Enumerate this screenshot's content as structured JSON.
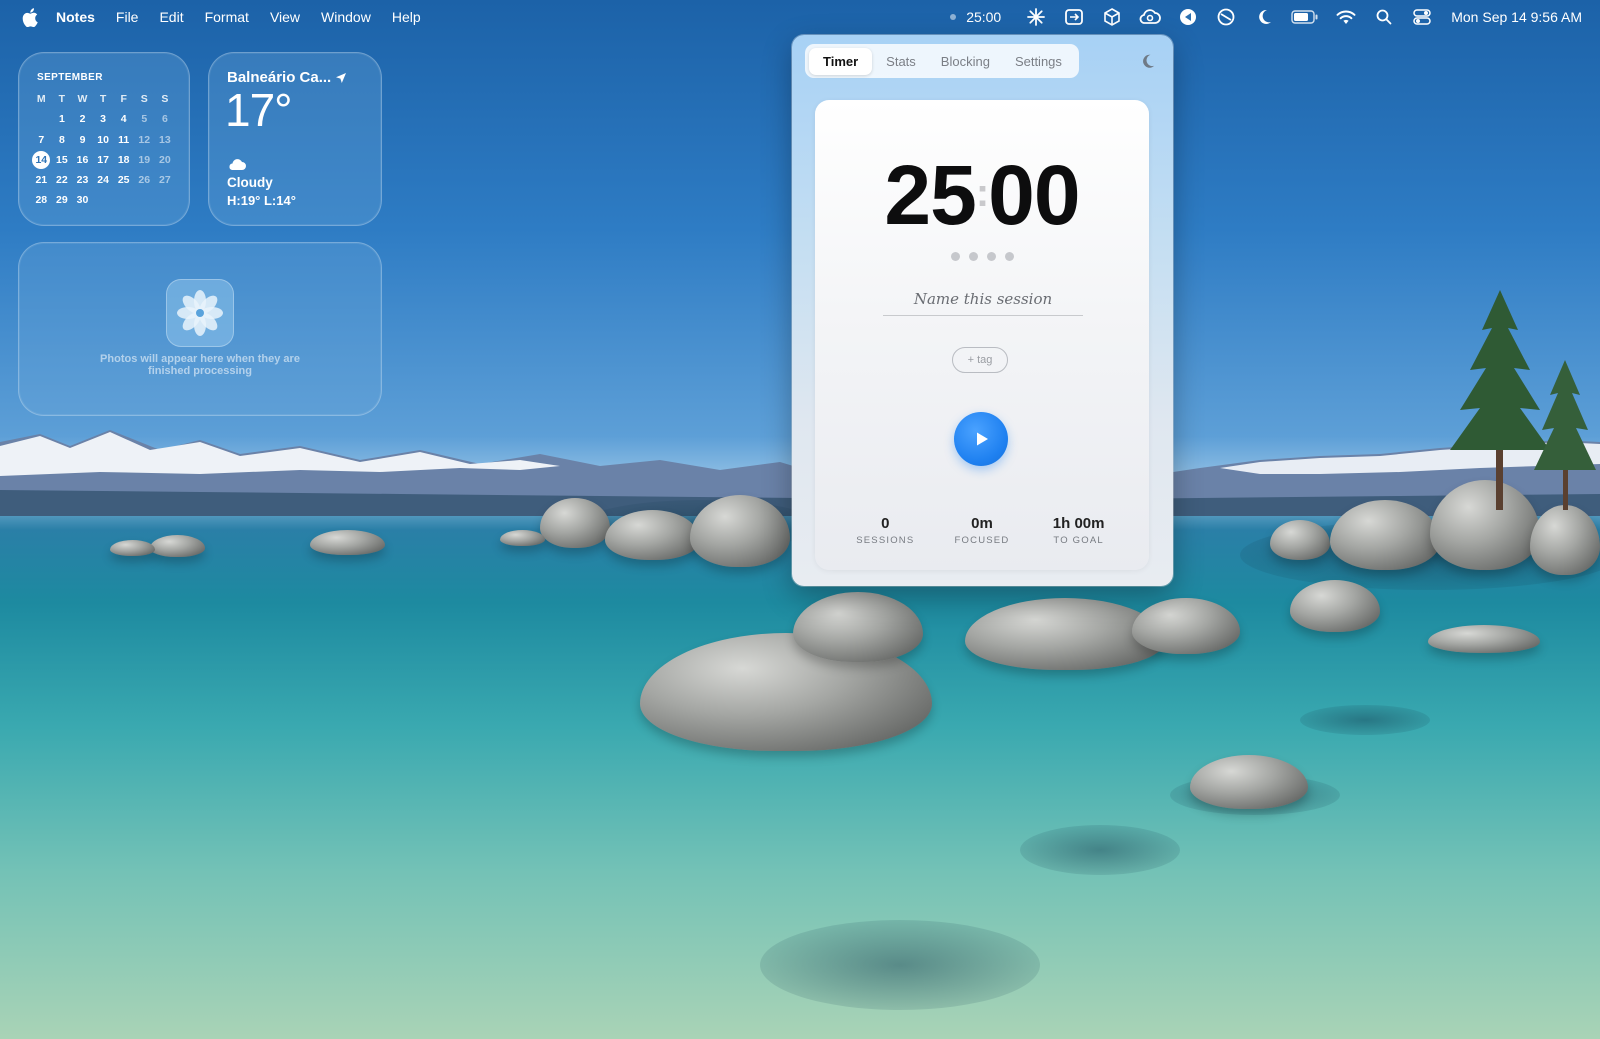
{
  "menubar": {
    "app_name": "Notes",
    "menus": [
      "File",
      "Edit",
      "Format",
      "View",
      "Window",
      "Help"
    ],
    "timer_status": "25:00",
    "status_icons": [
      "sparkle-icon",
      "remote-desktop-icon",
      "package-icon",
      "creative-cloud-icon",
      "dictation-icon",
      "do-not-disturb-icon",
      "moon-icon",
      "battery-icon",
      "wifi-icon",
      "search-icon",
      "control-center-icon"
    ],
    "clock": "Mon Sep 14  9:56 AM"
  },
  "calendar": {
    "month": "SEPTEMBER",
    "weekdays": [
      "M",
      "T",
      "W",
      "T",
      "F",
      "S",
      "S"
    ],
    "days": [
      "",
      "1",
      "2",
      "3",
      "4",
      "5",
      "6",
      "7",
      "8",
      "9",
      "10",
      "11",
      "12",
      "13",
      "14",
      "15",
      "16",
      "17",
      "18",
      "19",
      "20",
      "21",
      "22",
      "23",
      "24",
      "25",
      "26",
      "27",
      "28",
      "29",
      "30"
    ],
    "today": "14"
  },
  "weather": {
    "location": "Balneário Ca...",
    "temperature": "17°",
    "condition": "Cloudy",
    "high_low": "H:19° L:14°"
  },
  "photos": {
    "message_line1": "Photos will appear here when they are",
    "message_line2": "finished processing"
  },
  "timer_app": {
    "tabs": [
      "Timer",
      "Stats",
      "Blocking",
      "Settings"
    ],
    "active_tab": "Timer",
    "minutes": "25",
    "separator": ":",
    "seconds": "00",
    "session_placeholder": "Name this session",
    "tag_label": "+ tag",
    "sessions_value": "0",
    "sessions_label": "SESSIONS",
    "focused_value": "0m",
    "focused_label": "FOCUSED",
    "goal_value": "1h 00m",
    "goal_label": "TO GOAL",
    "accent_color": "#1e80f0"
  }
}
